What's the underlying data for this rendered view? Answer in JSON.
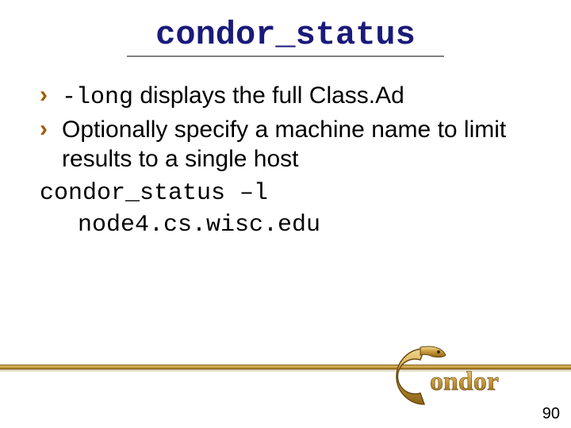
{
  "title": "condor_status",
  "bullets": [
    {
      "mono": "-long",
      "rest": " displays the full Class.Ad"
    },
    {
      "mono": "",
      "rest": "Optionally specify a machine name to limit results to a single host"
    }
  ],
  "command_line1": "condor_status –l",
  "command_line2": "node4.cs.wisc.edu",
  "page_number": "90",
  "logo_text": "ondor"
}
